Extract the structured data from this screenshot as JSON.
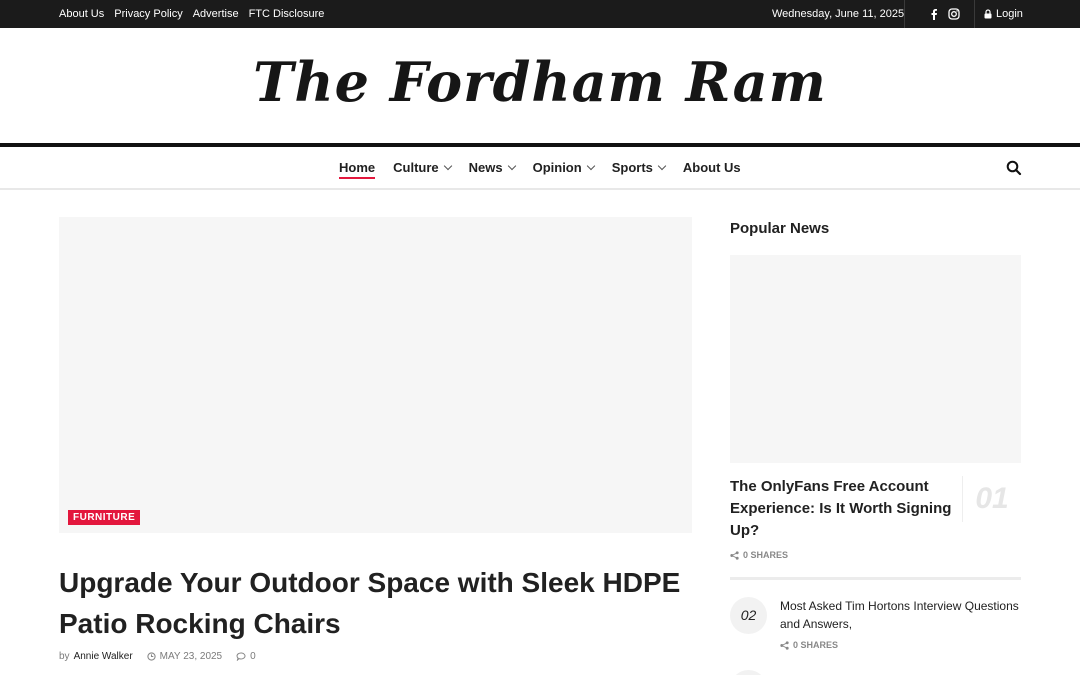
{
  "topbar": {
    "links": [
      "About Us",
      "Privacy Policy",
      "Advertise",
      "FTC Disclosure"
    ],
    "date": "Wednesday, June 11, 2025",
    "social_icons": [
      "facebook-icon",
      "instagram-icon"
    ],
    "login_label": "Login"
  },
  "masthead": {
    "logo_text": "The Fordham Ram"
  },
  "nav": {
    "items": [
      {
        "label": "Home",
        "active": true,
        "dropdown": false
      },
      {
        "label": "Culture",
        "active": false,
        "dropdown": true
      },
      {
        "label": "News",
        "active": false,
        "dropdown": true
      },
      {
        "label": "Opinion",
        "active": false,
        "dropdown": true
      },
      {
        "label": "Sports",
        "active": false,
        "dropdown": true
      },
      {
        "label": "About Us",
        "active": false,
        "dropdown": false
      }
    ]
  },
  "article": {
    "category": "FURNITURE",
    "title": "Upgrade Your Outdoor Space with Sleek HDPE Patio Rocking Chairs",
    "by": "by",
    "author": "Annie Walker",
    "date": "MAY 23, 2025",
    "comments": "0"
  },
  "sidebar": {
    "title": "Popular News",
    "posts": [
      {
        "number": "01",
        "title": "The OnlyFans Free Account Experience: Is It Worth Signing Up?",
        "shares": "0 SHARES"
      },
      {
        "number": "02",
        "title": "Most Asked Tim Hortons Interview Questions and Answers,",
        "shares": "0 SHARES"
      }
    ]
  },
  "colors": {
    "accent": "#e3173d",
    "topbar": "#1b1b1b"
  }
}
